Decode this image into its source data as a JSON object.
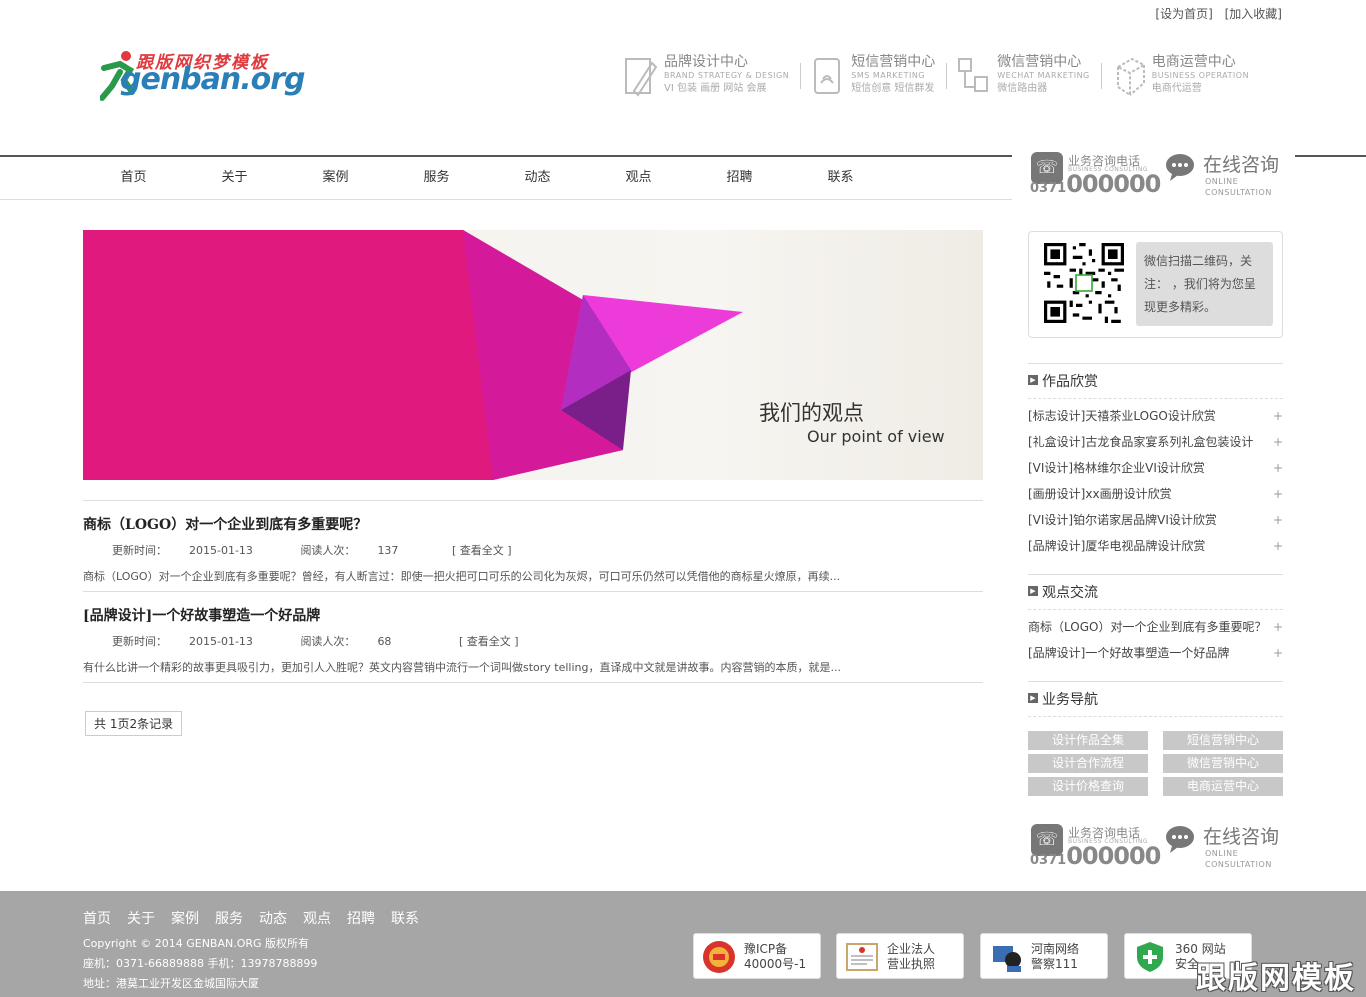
{
  "top_links": [
    "[设为首页]",
    "[加入收藏]"
  ],
  "logo": {
    "cn": "跟版网织梦模板",
    "en": "genban.org"
  },
  "centers": [
    {
      "title": "品牌设计中心",
      "sub": "BRAND STRATEGY & DESIGN",
      "desc": "VI  包装  画册  网站  会展",
      "icon": "pencil-doc-icon"
    },
    {
      "title": "短信营销中心",
      "sub": "SMS MARKETING",
      "desc": "短信创意 短信群发",
      "icon": "sms-icon"
    },
    {
      "title": "微信营销中心",
      "sub": "WECHAT MARKETING",
      "desc": "微信路由器",
      "icon": "network-icon"
    },
    {
      "title": "电商运营中心",
      "sub": "BUSINESS OPERATION",
      "desc": "电商代运营",
      "icon": "cube-icon"
    }
  ],
  "nav": [
    "首页",
    "关于",
    "案例",
    "服务",
    "动态",
    "观点",
    "招聘",
    "联系"
  ],
  "contact": {
    "label": "业务咨询电话",
    "label_en": "BUSINESS CONSULTING",
    "area": "0371",
    "number": "000000",
    "online": "在线咨询",
    "online_en1": "ONLINE",
    "online_en2": "CONSULTATION"
  },
  "banner": {
    "title": "我们的观点",
    "subtitle": "Our point of view"
  },
  "articles": [
    {
      "title": "商标（LOGO）对一个企业到底有多重要呢？",
      "date_label": "更新时间：",
      "date": "2015-01-13",
      "views_label": "阅读人次：",
      "views": "137",
      "readmore": "[ 查看全文 ]",
      "excerpt": "商标（LOGO）对一个企业到底有多重要呢？曾经，有人断言过：即使一把火把可口可乐的公司化为灰烬，可口可乐仍然可以凭借他的商标星火燎原，再续..."
    },
    {
      "title": "[品牌设计]一个好故事塑造一个好品牌",
      "date_label": "更新时间：",
      "date": "2015-01-13",
      "views_label": "阅读人次：",
      "views": "68",
      "readmore": "[ 查看全文 ]",
      "excerpt": "有什么比讲一个精彩的故事更具吸引力，更加引人入胜呢？英文内容营销中流行一个词叫做story telling，直译成中文就是讲故事。内容营销的本质，就是..."
    }
  ],
  "pager": "共 1页2条记录",
  "qr_text": "微信扫描二维码，关注：        ，我们将为您呈现更多精彩。",
  "works": {
    "title": "作品欣赏",
    "items": [
      "[标志设计]天禧茶业LOGO设计欣赏",
      "[礼盒设计]古龙食品家宴系列礼盒包装设计",
      "[VI设计]格林维尔企业VI设计欣赏",
      "[画册设计]xx画册设计欣赏",
      "[VI设计]铂尔诺家居品牌VI设计欣赏",
      "[品牌设计]厦华电视品牌设计欣赏"
    ]
  },
  "views": {
    "title": "观点交流",
    "items": [
      "商标（LOGO）对一个企业到底有多重要呢？",
      "[品牌设计]一个好故事塑造一个好品牌"
    ]
  },
  "biz": {
    "title": "业务导航",
    "items": [
      "设计作品全集",
      "短信营销中心",
      "设计合作流程",
      "微信营销中心",
      "设计价格查询",
      "电商运营中心"
    ]
  },
  "footer": {
    "nav": [
      "首页",
      "关于",
      "案例",
      "服务",
      "动态",
      "观点",
      "招聘",
      "联系"
    ],
    "copyright": "Copyright © 2014 GENBAN.ORG 版权所有",
    "phone": "座机：0371-66889888 手机：13978788899",
    "address": "地址：港莫工业开发区金城国际大厦",
    "badges": [
      {
        "l1": "豫ICP备",
        "l2": "40000号-1"
      },
      {
        "l1": "企业法人",
        "l2": "营业执照"
      },
      {
        "l1": "河南网络",
        "l2": "警察111"
      },
      {
        "l1": "360 网站",
        "l2": "安全"
      }
    ],
    "watermark": "跟版网模板"
  }
}
